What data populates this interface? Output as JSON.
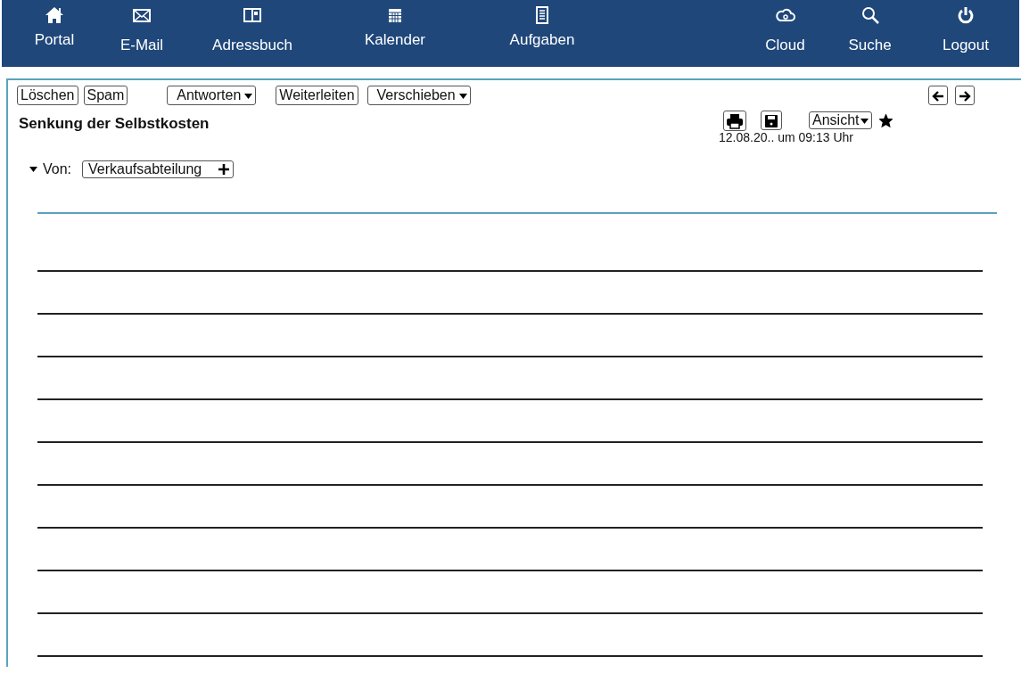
{
  "nav": {
    "left": [
      {
        "kind": "home",
        "label": "Portal"
      },
      {
        "kind": "mail",
        "label": "E-Mail"
      },
      {
        "kind": "book",
        "label": "Adressbuch"
      },
      {
        "kind": "calendar",
        "label": "Kalender"
      },
      {
        "kind": "tasks",
        "label": "Aufgaben"
      }
    ],
    "right": [
      {
        "kind": "cloud",
        "label": "Cloud"
      },
      {
        "kind": "search",
        "label": "Suche"
      },
      {
        "kind": "power",
        "label": "Logout"
      }
    ]
  },
  "toolbar": [
    {
      "label": "Löschen",
      "dropdown": false
    },
    {
      "label": "Spam",
      "dropdown": false
    },
    {
      "label": "Antworten",
      "dropdown": true
    },
    {
      "label": "Weiterleiten",
      "dropdown": false
    },
    {
      "label": "Verschieben",
      "dropdown": true
    }
  ],
  "message": {
    "subject": "Senkung der Selbstkosten",
    "view_button": "Ansicht",
    "starred": true,
    "date": "12.08.20.. um 09:13 Uhr",
    "from": {
      "label": "Von:",
      "sender": "Verkaufsabteilung",
      "expanded": true
    }
  }
}
